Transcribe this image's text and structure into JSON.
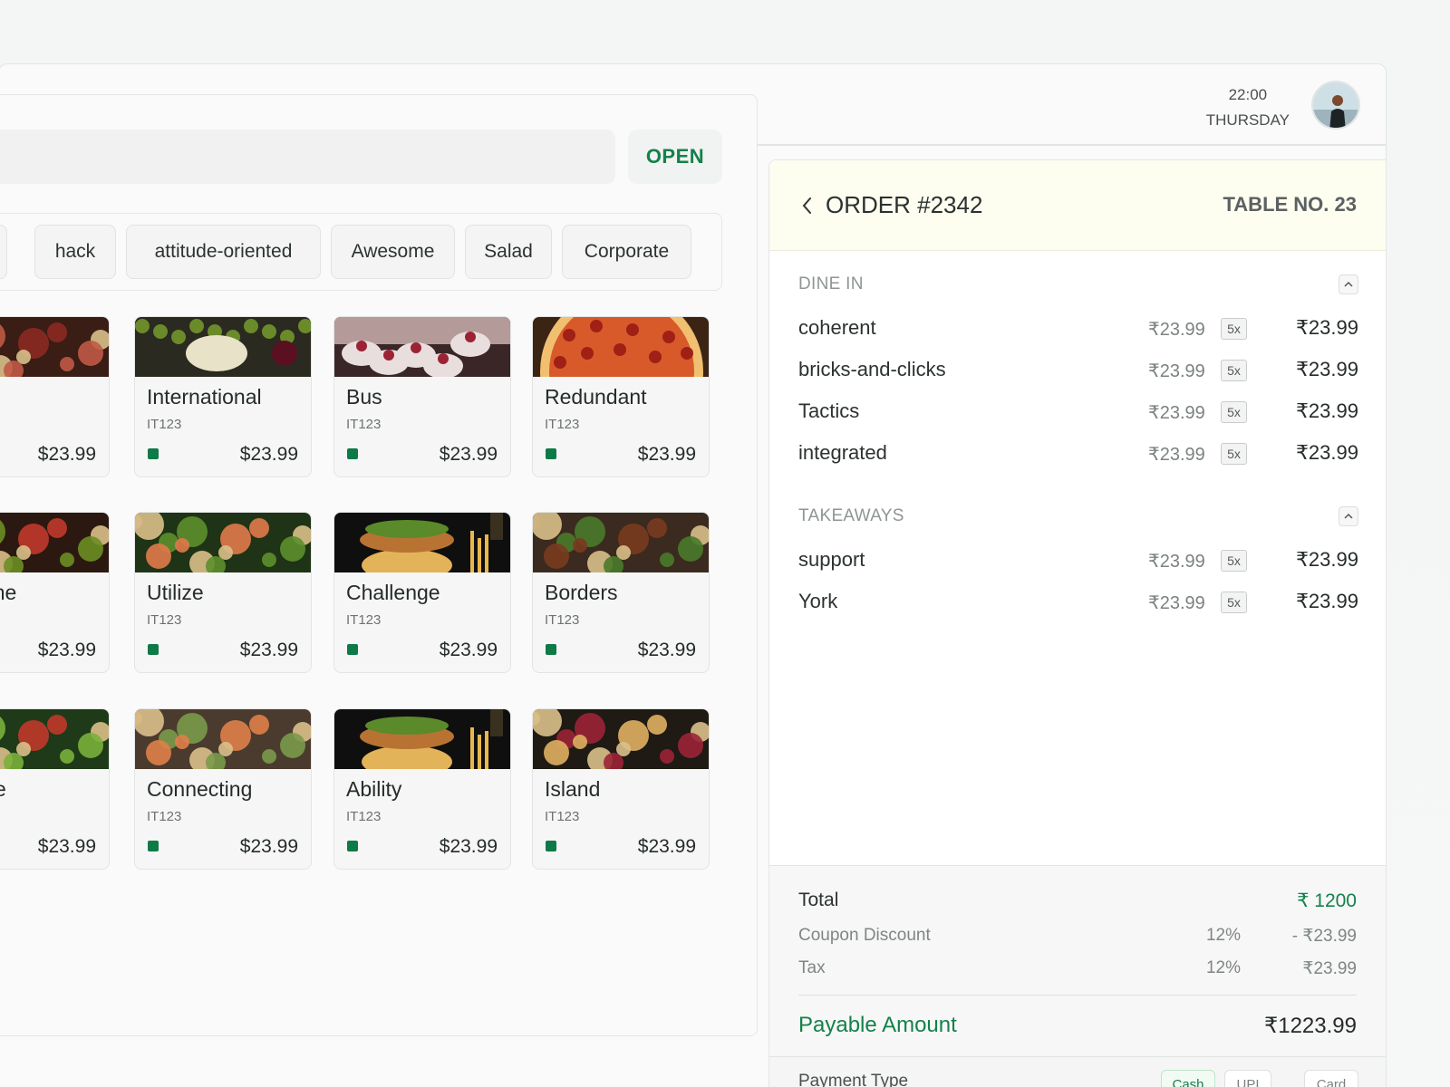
{
  "header": {
    "time": "22:00",
    "day": "Thursday"
  },
  "menu": {
    "open_label": "OPEN",
    "categories": [
      "e",
      "hack",
      "attitude-oriented",
      "Awesome",
      "Salad",
      "Corporate"
    ],
    "items": [
      {
        "name": "",
        "code": "",
        "price": "$23.99",
        "img": "meat"
      },
      {
        "name": "International",
        "code": "IT123",
        "price": "$23.99",
        "img": "cheese"
      },
      {
        "name": "Bus",
        "code": "IT123",
        "price": "$23.99",
        "img": "dessert"
      },
      {
        "name": "Redundant",
        "code": "IT123",
        "price": "$23.99",
        "img": "pizza"
      },
      {
        "name": "d-Alone",
        "code": "",
        "price": "$23.99",
        "img": "burger-side"
      },
      {
        "name": "Utilize",
        "code": "IT123",
        "price": "$23.99",
        "img": "shrimp-salad"
      },
      {
        "name": "Challenge",
        "code": "IT123",
        "price": "$23.99",
        "img": "burger"
      },
      {
        "name": "Borders",
        "code": "IT123",
        "price": "$23.99",
        "img": "steak"
      },
      {
        "name": "motive",
        "code": "",
        "price": "$23.99",
        "img": "salad"
      },
      {
        "name": "Connecting",
        "code": "IT123",
        "price": "$23.99",
        "img": "seafood"
      },
      {
        "name": "Ability",
        "code": "IT123",
        "price": "$23.99",
        "img": "burger"
      },
      {
        "name": "Island",
        "code": "IT123",
        "price": "$23.99",
        "img": "platter"
      }
    ]
  },
  "order": {
    "title": "ORDER #2342",
    "table": "TABLE NO. 23",
    "dine_in_label": "DINE IN",
    "takeaways_label": "TAKEAWAYS",
    "dine_in": [
      {
        "name": "coherent",
        "price": "₹23.99",
        "qty": "5x",
        "total": "₹23.99"
      },
      {
        "name": "bricks-and-clicks",
        "price": "₹23.99",
        "qty": "5x",
        "total": "₹23.99"
      },
      {
        "name": "Tactics",
        "price": "₹23.99",
        "qty": "5x",
        "total": "₹23.99"
      },
      {
        "name": "integrated",
        "price": "₹23.99",
        "qty": "5x",
        "total": "₹23.99"
      }
    ],
    "takeaways": [
      {
        "name": "support",
        "price": "₹23.99",
        "qty": "5x",
        "total": "₹23.99"
      },
      {
        "name": "York",
        "price": "₹23.99",
        "qty": "5x",
        "total": "₹23.99"
      }
    ],
    "summary": {
      "total_label": "Total",
      "total_value": "₹ 1200",
      "coupon_label": "Coupon Discount",
      "coupon_pct": "12%",
      "coupon_value": "- ₹23.99",
      "tax_label": "Tax",
      "tax_pct": "12%",
      "tax_value": "₹23.99",
      "payable_label": "Payable Amount",
      "payable_value": "₹1223.99"
    },
    "payment": {
      "label": "Payment Type",
      "options": [
        "Cash",
        "UPI",
        "Card"
      ]
    }
  },
  "colors": {
    "accent": "#14814a",
    "order_header_bg": "#fdfdf0"
  }
}
